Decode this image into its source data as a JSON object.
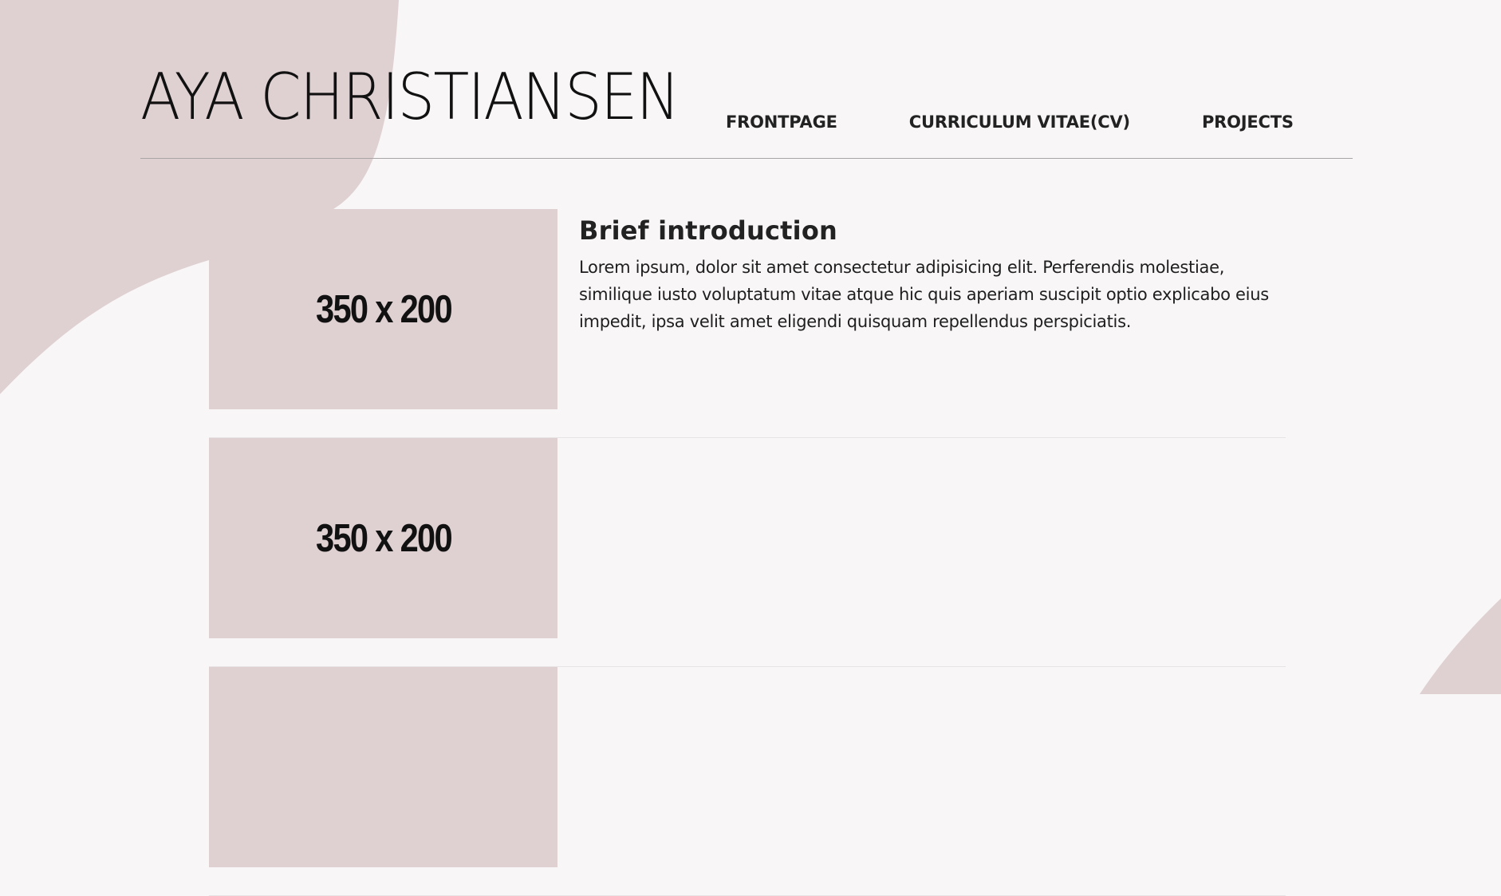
{
  "header": {
    "title": "AYA CHRISTIANSEN",
    "nav": [
      {
        "label": "FRONTPAGE"
      },
      {
        "label": "CURRICULUM VITAE(CV)"
      },
      {
        "label": "PROJECTS"
      }
    ]
  },
  "projects": [
    {
      "thumb_label": "350 x 200",
      "heading": "Brief introduction",
      "text": "Lorem ipsum, dolor sit amet consectetur adipisicing elit. Perferendis molestiae, similique iusto voluptatum vitae atque hic quis aperiam suscipit optio explicabo eius impedit, ipsa velit amet eligendi quisquam repellendus perspiciatis."
    },
    {
      "thumb_label": "350 x 200"
    },
    {
      "thumb_label": ""
    }
  ],
  "colors": {
    "background": "#f8f6f7",
    "accent_blob": "#dfd0d2",
    "text": "#1e1e1e",
    "divider": "#a9a4a6"
  }
}
